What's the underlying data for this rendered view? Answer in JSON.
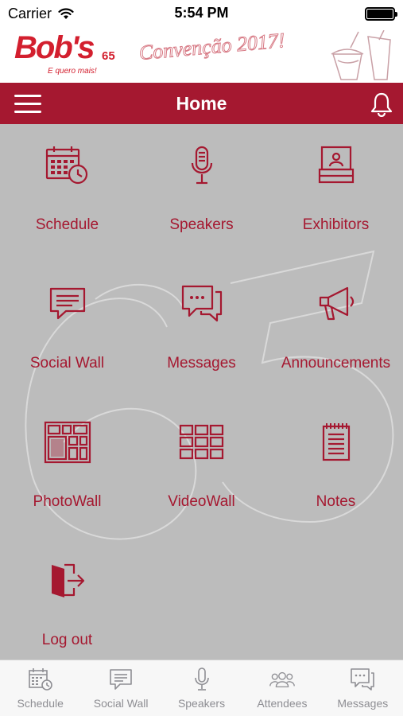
{
  "status_bar": {
    "carrier": "Carrier",
    "time": "5:54 PM"
  },
  "banner": {
    "logo": "Bob's",
    "logo_number": "65",
    "tagline": "E quero mais!",
    "event_title": "Convenção 2017!"
  },
  "header": {
    "title": "Home"
  },
  "menu": [
    {
      "label": "Schedule",
      "icon": "calendar-clock-icon"
    },
    {
      "label": "Speakers",
      "icon": "microphone-icon"
    },
    {
      "label": "Exhibitors",
      "icon": "exhibitor-booth-icon"
    },
    {
      "label": "Social Wall",
      "icon": "chat-bubble-icon"
    },
    {
      "label": "Messages",
      "icon": "messages-icon"
    },
    {
      "label": "Announcements",
      "icon": "megaphone-icon"
    },
    {
      "label": "PhotoWall",
      "icon": "photo-grid-icon"
    },
    {
      "label": "VideoWall",
      "icon": "video-grid-icon"
    },
    {
      "label": "Notes",
      "icon": "notepad-icon"
    },
    {
      "label": "Log out",
      "icon": "logout-door-icon"
    }
  ],
  "tabbar": [
    {
      "label": "Schedule",
      "icon": "calendar-clock-icon"
    },
    {
      "label": "Social Wall",
      "icon": "chat-bubble-icon"
    },
    {
      "label": "Speakers",
      "icon": "microphone-icon"
    },
    {
      "label": "Attendees",
      "icon": "people-icon"
    },
    {
      "label": "Messages",
      "icon": "messages-icon"
    }
  ],
  "colors": {
    "brand": "#a51830",
    "logo_red": "#d31f2e",
    "grid_bg": "#bcbcbc",
    "tab_gray": "#8e8e93"
  }
}
